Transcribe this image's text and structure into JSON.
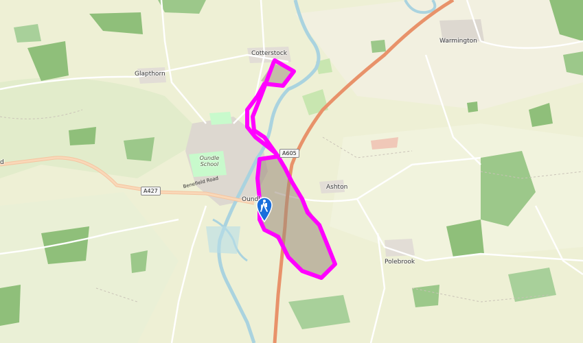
{
  "places": {
    "cotterstock": "Cotterstock",
    "warmington": "Warmington",
    "glapthorn": "Glapthorn",
    "oundle": "Oundle",
    "ashton": "Ashton",
    "polebrook": "Polebrook",
    "oundle_school": "Oundle School",
    "road_a": "d"
  },
  "roads": {
    "a427": "A427",
    "a605": "A605",
    "benefield_road": "Benefield Road"
  },
  "colors": {
    "route": "#ff00ff",
    "major_road": "#e8926a",
    "water": "#aad3df",
    "wood": "#add19e",
    "park": "#c8facc",
    "farmland": "#eef0d5",
    "background": "#f2efe9"
  },
  "icons": {
    "start_marker": "hiker-marker-icon"
  }
}
